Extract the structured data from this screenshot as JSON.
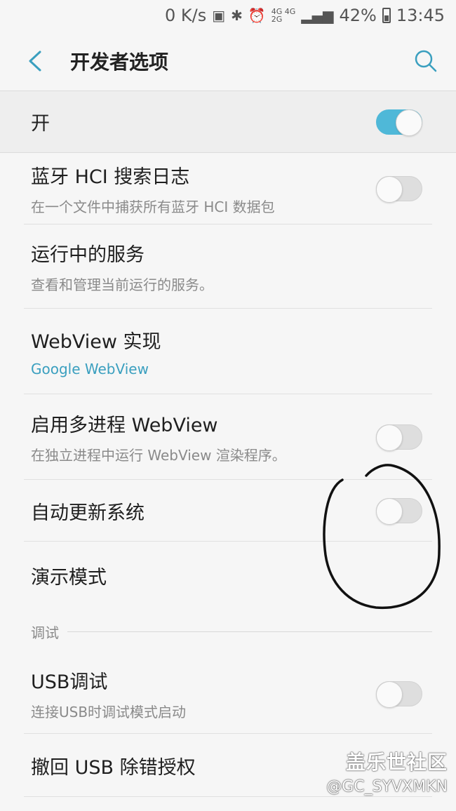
{
  "status_bar": {
    "speed": "0 K/s",
    "network_top": "4G 4G",
    "network_bottom": "2G",
    "battery": "42%",
    "time": "13:45"
  },
  "app_bar": {
    "title": "开发者选项"
  },
  "master_switch": {
    "label": "开",
    "on": true
  },
  "items": [
    {
      "primary": "蓝牙 HCI 搜索日志",
      "secondary": "在一个文件中捕获所有蓝牙 HCI 数据包",
      "toggle": false
    },
    {
      "primary": "运行中的服务",
      "secondary": "查看和管理当前运行的服务。"
    },
    {
      "primary": "WebView 实现",
      "secondary": "Google WebView"
    },
    {
      "primary": "启用多进程 WebView",
      "secondary": "在独立进程中运行 WebView 渲染程序。",
      "toggle": false
    },
    {
      "primary": "自动更新系统",
      "toggle": false
    },
    {
      "primary": "演示模式"
    }
  ],
  "section_debug": {
    "label": "调试"
  },
  "debug_items": [
    {
      "primary": "USB调试",
      "secondary": "连接USB时调试模式启动",
      "toggle": false
    },
    {
      "primary": "撤回 USB 除错授权"
    }
  ],
  "watermark": {
    "brand": "盖乐世社区",
    "handle": "@GC_SYVXMKN"
  },
  "colors": {
    "accent": "#4fb8d8",
    "link": "#3a9fbf"
  }
}
